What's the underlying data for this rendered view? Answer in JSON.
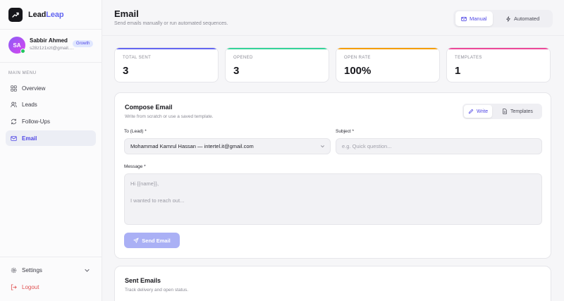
{
  "brand": {
    "name_part1": "Lead",
    "name_part2": "Leap"
  },
  "user": {
    "initials": "SA",
    "name": "Sabbir Ahmed",
    "email": "s28z1z1xzt@gmail.com",
    "plan": "Growth"
  },
  "sidebar": {
    "menu_heading": "MAIN MENU",
    "items": [
      {
        "label": "Overview",
        "icon": "grid-icon"
      },
      {
        "label": "Leads",
        "icon": "users-icon"
      },
      {
        "label": "Follow-Ups",
        "icon": "refresh-icon"
      },
      {
        "label": "Email",
        "icon": "mail-icon",
        "active": true
      }
    ],
    "settings_label": "Settings",
    "logout_label": "Logout"
  },
  "header": {
    "title": "Email",
    "subtitle": "Send emails manually or run automated sequences.",
    "mode_manual": "Manual",
    "mode_automated": "Automated"
  },
  "stats": [
    {
      "label": "TOTAL SENT",
      "value": "3",
      "color": "#6366f1"
    },
    {
      "label": "OPENED",
      "value": "3",
      "color": "#34d399"
    },
    {
      "label": "OPEN RATE",
      "value": "100%",
      "color": "#f59e0b"
    },
    {
      "label": "TEMPLATES",
      "value": "1",
      "color": "#ec4899"
    }
  ],
  "compose": {
    "title": "Compose Email",
    "subtitle": "Write from scratch or use a saved template.",
    "tab_write": "Write",
    "tab_templates": "Templates",
    "to_label": "To (Lead) *",
    "to_value": "Mohammad Kamrul Hassan — intertel.it@gmail.com",
    "subject_label": "Subject *",
    "subject_placeholder": "e.g. Quick question...",
    "message_label": "Message *",
    "message_line1": "Hi {{name}},",
    "message_line2": "I wanted to reach out...",
    "send_label": "Send Email"
  },
  "sent": {
    "title": "Sent Emails",
    "subtitle": "Track delivery and open status."
  },
  "colors": {
    "accent": "#4f46e5",
    "logout": "#e05252"
  }
}
